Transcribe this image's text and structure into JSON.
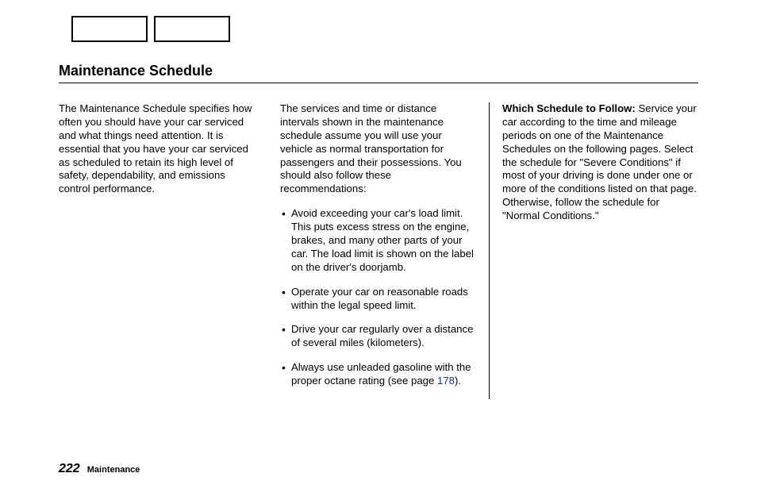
{
  "title": "Maintenance Schedule",
  "col1": {
    "p1": "The Maintenance Schedule specifies how often you should have your car serviced and what things need attention. It is essential that you have your car serviced as scheduled to retain its high level of safety, dependability, and emissions control performance."
  },
  "col2": {
    "intro": "The services and time or distance intervals shown in the maintenance schedule assume you will use your vehicle as normal transportation for passengers and their possessions. You should also follow these recommendations:",
    "bullets": [
      "Avoid exceeding your car's load limit. This puts excess stress on the engine, brakes, and many other parts of your car. The load limit is shown on the label on the driver's doorjamb.",
      "Operate your car on reasonable roads within the legal speed limit.",
      "Drive your car regularly over a distance of several miles (kilometers)."
    ],
    "bullet4_pre": "Always use unleaded gasoline with the proper octane rating (see page ",
    "bullet4_link": "178",
    "bullet4_post": ")."
  },
  "col3": {
    "heading": "Which Schedule to Follow:",
    "body": "Service your car according to the time and mileage periods on one of the Maintenance Schedules on the following pages. Select the schedule for \"Severe Conditions\" if most of your driving is done under one or more of the conditions listed on that page. Otherwise, follow the schedule for \"Normal Conditions.\""
  },
  "footer": {
    "page": "222",
    "section": "Maintenance"
  }
}
